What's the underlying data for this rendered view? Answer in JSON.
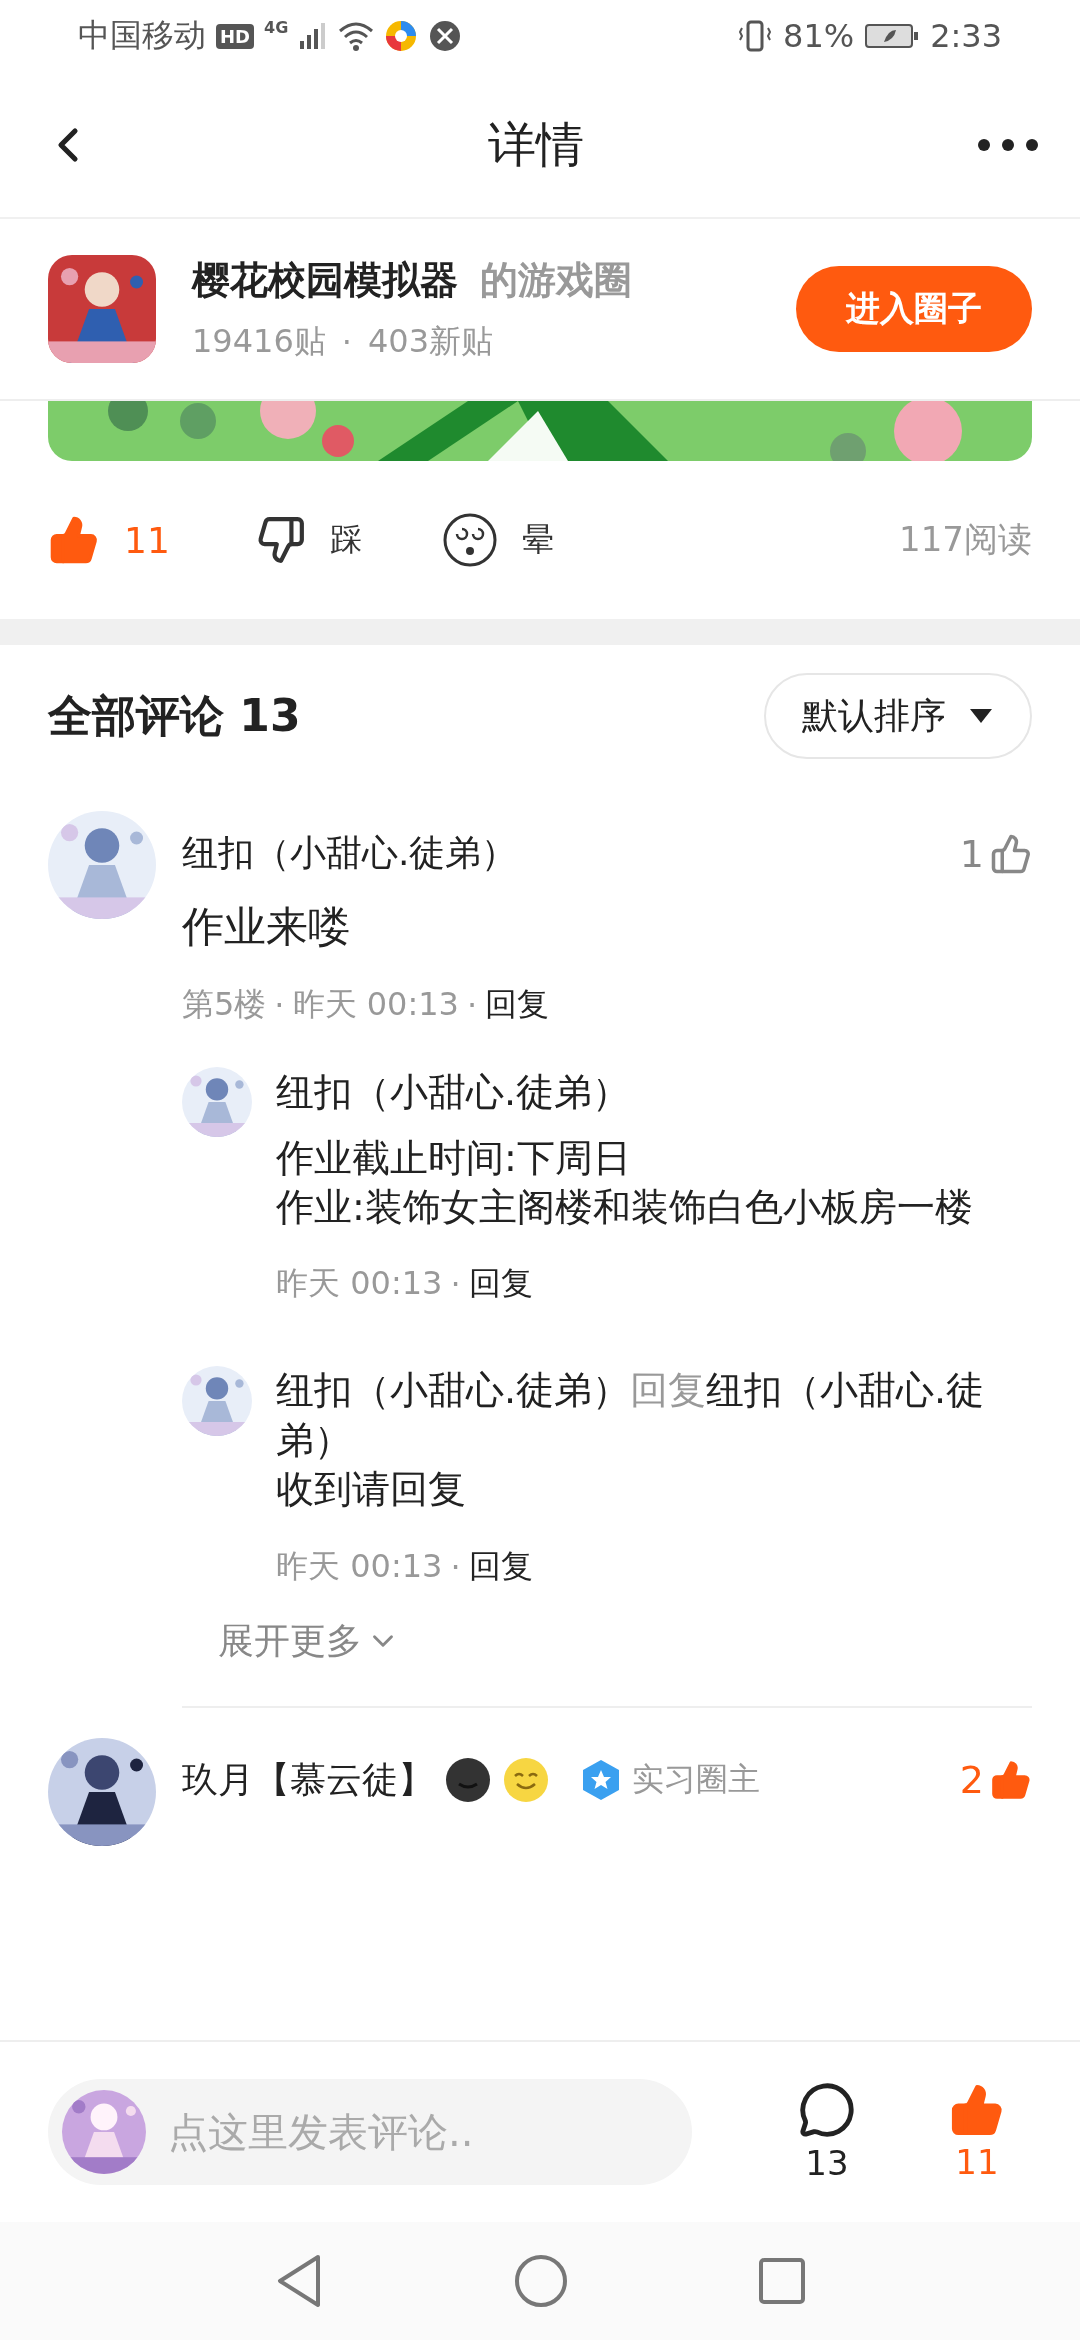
{
  "status_bar": {
    "carrier": "中国移动",
    "hd": "HD",
    "network": "4G",
    "battery": "81%",
    "time": "2:33"
  },
  "header": {
    "title": "详情"
  },
  "circle": {
    "name": "樱花校园模拟器",
    "suffix": "的游戏圈",
    "posts": "19416贴",
    "separator": "·",
    "new_posts": "403新贴",
    "button": "进入圈子"
  },
  "actions": {
    "like": {
      "count": "11",
      "selected": true
    },
    "dislike": {
      "label": "踩"
    },
    "dizzy": {
      "label": "晕"
    },
    "reads": "117阅读"
  },
  "comments_header": {
    "title": "全部评论 13",
    "sort": "默认排序"
  },
  "comments": [
    {
      "user": "纽扣（小甜心.徒弟）",
      "likes": "1",
      "liked": false,
      "text": "作业来喽",
      "floor": "第5楼",
      "separator": "·",
      "time": "昨天 00:13",
      "separator_2": "·",
      "reply": "回复",
      "replies": [
        {
          "user": "纽扣（小甜心.徒弟）",
          "lines": [
            "作业截止时间:下周日",
            "作业:装饰女主阁楼和装饰白色小板房一楼"
          ],
          "time": "昨天 00:13",
          "separator": "·",
          "reply": "回复"
        },
        {
          "user": "纽扣（小甜心.徒弟）",
          "reply_word": "回复",
          "target": "纽扣（小甜心.徒弟）",
          "lines": [
            "收到请回复"
          ],
          "time": "昨天 00:13",
          "separator": "·",
          "reply": "回复"
        }
      ],
      "more": "展开更多"
    },
    {
      "user": "玖月【慕云徒】",
      "badge": "实习圈主",
      "likes": "2",
      "liked": true
    }
  ],
  "bottom_bar": {
    "placeholder": "点这里发表评论..",
    "comments": "13",
    "likes": "11",
    "liked": true
  }
}
